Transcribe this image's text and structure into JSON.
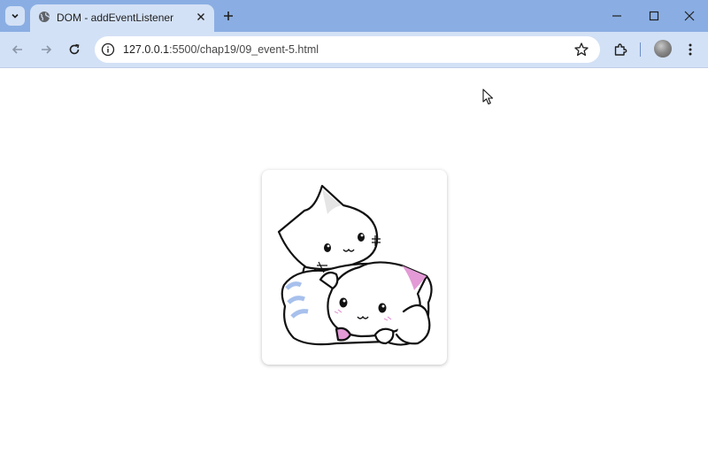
{
  "browser": {
    "tab": {
      "title": "DOM - addEventListener"
    },
    "address_bar": {
      "host": "127.0.0.1",
      "path": ":5500/chap19/09_event-5.html"
    },
    "icons": {
      "tab_search": "chevron-down-icon",
      "favicon": "globe-icon",
      "close": "close-icon",
      "new_tab": "plus-icon",
      "back": "back-arrow-icon",
      "forward": "forward-arrow-icon",
      "reload": "reload-icon",
      "site_info": "info-icon",
      "bookmark": "star-icon",
      "extensions": "puzzle-icon",
      "menu": "kebab-menu-icon"
    },
    "colors": {
      "tab_strip": "#8aaee3",
      "toolbar": "#d3e1f6",
      "page": "#ffffff"
    }
  },
  "page": {
    "image": {
      "subject": "two-kittens-illustration",
      "accent_colors": [
        "#e39ad6",
        "#a7c0ec"
      ]
    }
  }
}
